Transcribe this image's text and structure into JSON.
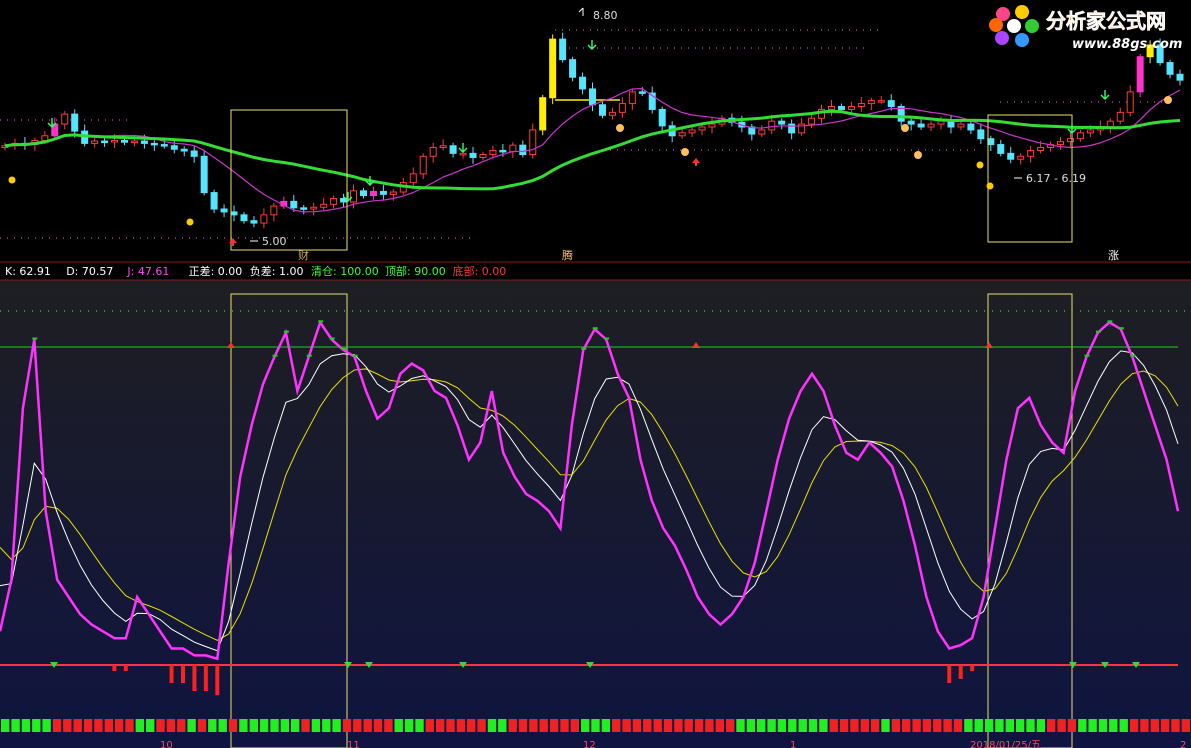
{
  "logo": {
    "title": "分析家公式网",
    "url": "www.88gs.com"
  },
  "price_annotations": {
    "high": "8.80",
    "low": "5.00",
    "range": "6.17 - 6.19"
  },
  "box_labels": [
    "财",
    "腾",
    "涨"
  ],
  "status_bar": [
    {
      "text": "K: 62.91",
      "color": "#ffffff"
    },
    {
      "text": "D: 70.57",
      "color": "#ffffff"
    },
    {
      "text": "J: 47.61",
      "color": "#ff44ff"
    },
    {
      "text": "正差: 0.00",
      "color": "#ffffff"
    },
    {
      "text": "负差: 1.00",
      "color": "#ffffff"
    },
    {
      "text": "清仓: 100.00",
      "color": "#33ff33"
    },
    {
      "text": "顶部: 90.00",
      "color": "#33ff33"
    },
    {
      "text": "底部: 0.00",
      "color": "#ff3333"
    }
  ],
  "date_labels": [
    "10",
    "11",
    "12",
    "1",
    "2018/01/25/五",
    "2"
  ],
  "colors": {
    "up": "#ff3b3b",
    "down": "#55e5ff",
    "yellow": "#ffee00",
    "magenta": "#ff33cc",
    "ma_long": "#33dd33",
    "ma_short": "#cc33cc",
    "box": "#e8e070",
    "k": "#ffffff",
    "d": "#e8e000",
    "j": "#ff33ff",
    "top_line": "#22cc22"
  },
  "chart_data": {
    "type": "candlestick+kdj",
    "price": {
      "ylim": [
        4.8,
        9.0
      ],
      "closes": [
        6.58,
        6.62,
        6.6,
        6.67,
        6.75,
        6.95,
        7.12,
        6.83,
        6.62,
        6.66,
        6.65,
        6.67,
        6.64,
        6.66,
        6.62,
        6.6,
        6.58,
        6.52,
        6.49,
        6.4,
        5.78,
        5.5,
        5.45,
        5.4,
        5.3,
        5.26,
        5.4,
        5.55,
        5.63,
        5.52,
        5.5,
        5.53,
        5.58,
        5.68,
        5.62,
        5.81,
        5.73,
        5.8,
        5.75,
        5.79,
        5.95,
        6.1,
        6.4,
        6.55,
        6.58,
        6.45,
        6.45,
        6.38,
        6.43,
        6.5,
        6.48,
        6.59,
        6.43,
        6.85,
        7.4,
        8.4,
        8.05,
        7.75,
        7.55,
        7.28,
        7.1,
        7.15,
        7.3,
        7.5,
        7.48,
        7.2,
        6.92,
        6.75,
        6.8,
        6.85,
        6.9,
        6.95,
        7.05,
        6.98,
        6.9,
        6.78,
        6.85,
        7.0,
        6.95,
        6.8,
        6.95,
        7.05,
        7.2,
        7.25,
        7.2,
        7.25,
        7.3,
        7.35,
        7.35,
        7.25,
        7.0,
        6.95,
        6.9,
        6.95,
        7.0,
        6.9,
        6.95,
        6.85,
        6.7,
        6.6,
        6.45,
        6.35,
        6.4,
        6.5,
        6.55,
        6.6,
        6.65,
        6.7,
        6.8,
        6.85,
        6.9,
        7.0,
        7.15,
        7.5,
        8.1,
        8.3,
        8.0,
        7.8,
        7.7
      ]
    },
    "kdj": {
      "ylim": [
        -10,
        110
      ],
      "j": [
        10,
        25,
        75,
        95,
        45,
        25,
        20,
        15,
        12,
        10,
        8,
        8,
        20,
        15,
        10,
        5,
        5,
        3,
        3,
        2,
        30,
        55,
        70,
        82,
        90,
        97,
        80,
        90,
        100,
        95,
        92,
        90,
        80,
        72,
        75,
        85,
        88,
        86,
        80,
        78,
        70,
        60,
        65,
        80,
        62,
        55,
        50,
        48,
        45,
        40,
        70,
        92,
        98,
        95,
        85,
        78,
        60,
        48,
        40,
        35,
        28,
        20,
        15,
        12,
        15,
        20,
        30,
        45,
        60,
        72,
        80,
        85,
        80,
        70,
        62,
        60,
        65,
        62,
        58,
        48,
        35,
        20,
        10,
        5,
        6,
        8,
        20,
        40,
        60,
        75,
        78,
        70,
        65,
        62,
        80,
        90,
        97,
        100,
        98,
        90,
        80,
        70,
        60,
        45
      ]
    }
  }
}
